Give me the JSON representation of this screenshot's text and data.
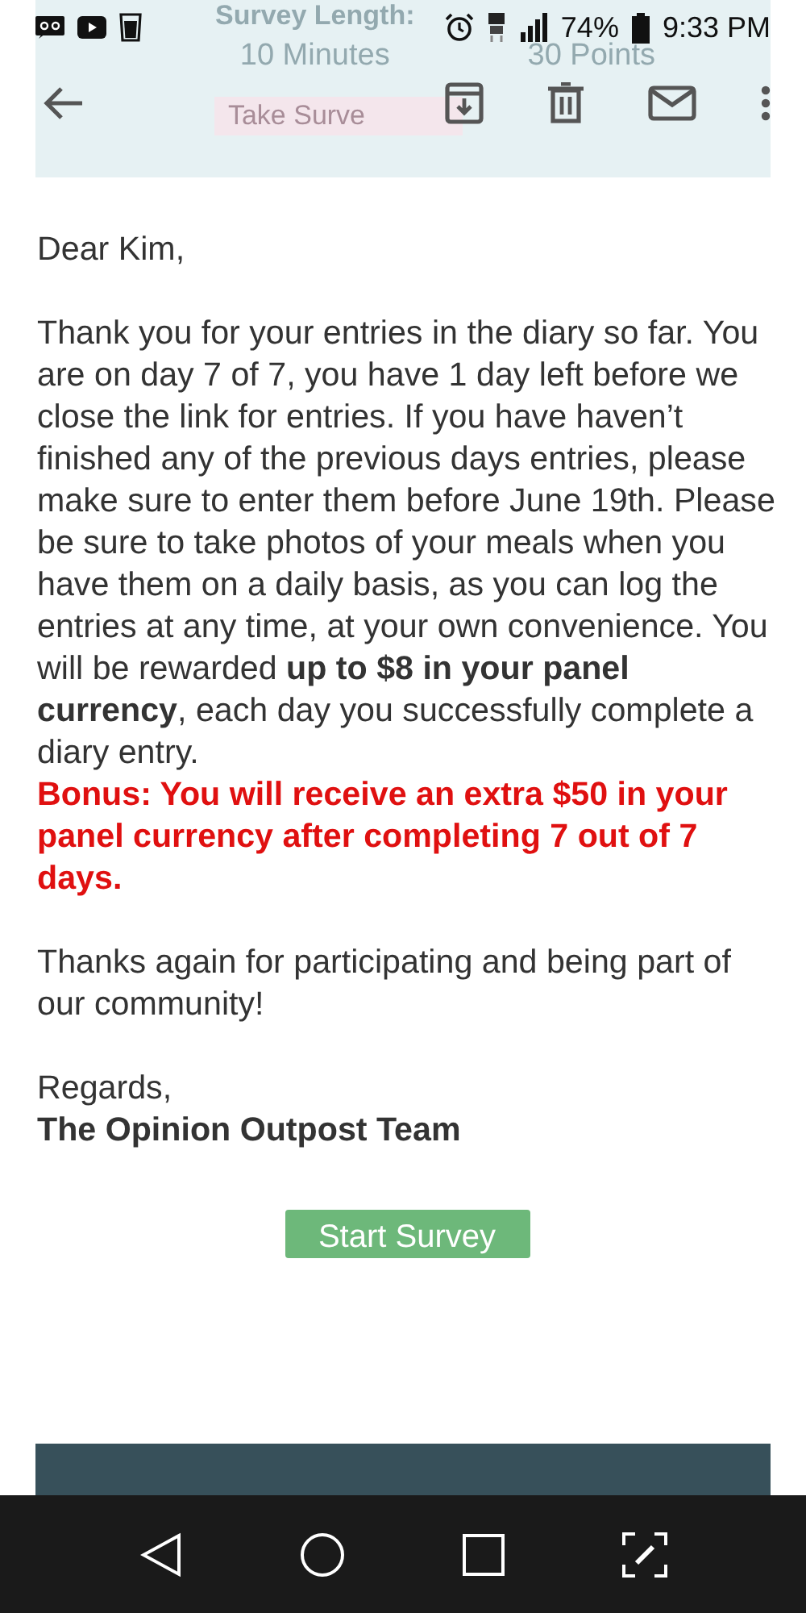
{
  "banner": {
    "items": [
      {
        "label": "Survey Length:",
        "value": "10 Minutes"
      },
      {
        "value": "30 Points"
      }
    ],
    "button": "Take Surve"
  },
  "status_bar": {
    "battery": "74%",
    "time": "9:33 PM"
  },
  "email": {
    "greeting": "Dear Kim,",
    "paragraphs": [
      {
        "kind": "body",
        "text": "Thank you for your entries in the diary so far. You are on day 7 of 7, you have 1 day left before we close the link for entries. If you have haven’t finished any of the previous days entries, please make sure to enter them before June 19th. Please be sure to take photos of your meals when you have them on a daily basis, as you can log the entries at any time, at your own convenience. You will be rewarded **up to $8 in your panel currency**, each day you successfully complete a diary entry."
      },
      {
        "kind": "alert",
        "text": "Bonus: You will receive an extra $50 in your panel currency after completing 7 out of 7 days."
      },
      {
        "kind": "gap",
        "text": "Thanks again for participating and being part of our community!"
      }
    ],
    "closing": "Regards,",
    "signature": "The Opinion Outpost Team",
    "button": "Start Survey"
  }
}
